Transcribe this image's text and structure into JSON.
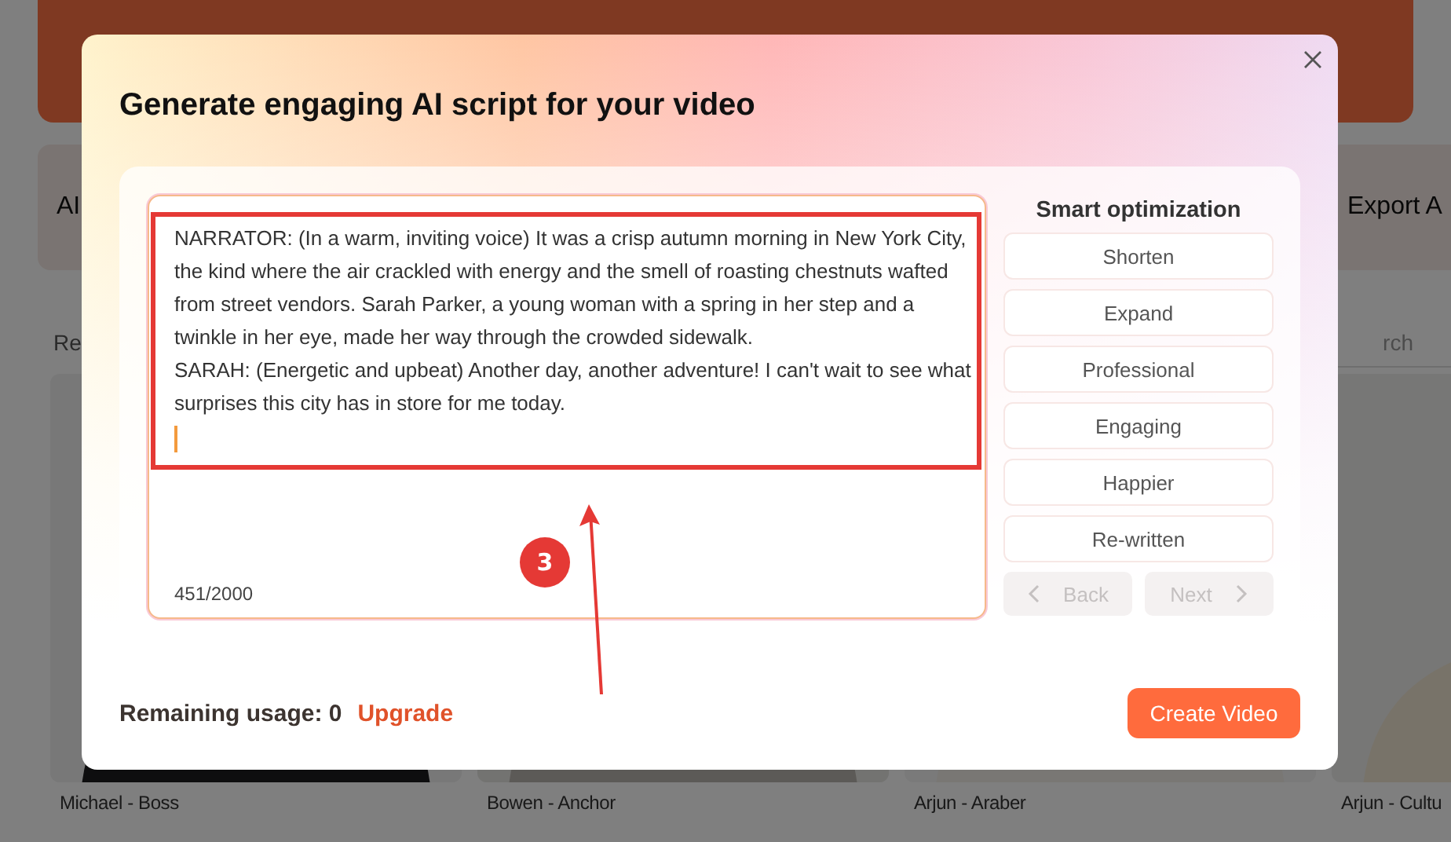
{
  "background": {
    "cards": [
      {
        "label": "AI"
      },
      {
        "label": "Export A"
      }
    ],
    "section_label": "Re",
    "search": {
      "placeholder": "rch"
    },
    "avatars": [
      {
        "name": "Michael - Boss",
        "kind": "picture"
      },
      {
        "name": "Bowen - Anchor",
        "kind": "picture"
      },
      {
        "name": "Arjun - Araber",
        "kind": "picture"
      },
      {
        "name": "Arjun - Cultu",
        "kind": "picture"
      }
    ]
  },
  "dialog": {
    "title": "Generate engaging AI script for your video",
    "script": {
      "paragraphs": [
        "NARRATOR: (In a warm, inviting voice) It was a crisp autumn morning in New York City, the kind where the air crackled with energy and the smell of roasting chestnuts wafted from street vendors. Sarah Parker, a young woman with a spring in her step and a twinkle in her eye, made her way through the crowded sidewalk.",
        "SARAH: (Energetic and upbeat) Another day, another adventure! I can't wait to see what surprises this city has in store for me today."
      ],
      "counter": "451/2000"
    },
    "smart_optimization": {
      "title": "Smart optimization",
      "options": [
        "Shorten",
        "Expand",
        "Professional",
        "Engaging",
        "Happier",
        "Re-written"
      ]
    },
    "pager": [
      {
        "label": "Back",
        "kind": "back",
        "disabled": true
      },
      {
        "label": "Next",
        "kind": "next",
        "disabled": true
      }
    ],
    "remaining_usage": "Remaining usage: 0",
    "upgrade_link": "Upgrade",
    "create_button": "Create Video"
  },
  "annotation": {
    "step": "3"
  }
}
